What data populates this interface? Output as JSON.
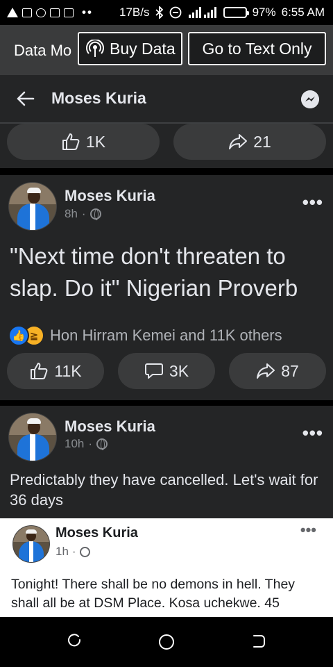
{
  "status_bar": {
    "net_speed": "17B/s",
    "battery": "97%",
    "battery_level": 0.97,
    "time": "6:55 AM"
  },
  "data_banner": {
    "text": "Data Mo",
    "buy_data_label": "Buy Data",
    "go_text_only_label": "Go to Text Only"
  },
  "header": {
    "title": "Moses Kuria"
  },
  "top_actions": {
    "like_count": "1K",
    "share_count": "21"
  },
  "posts": [
    {
      "author": "Moses Kuria",
      "time": "8h",
      "text": "\"Next time don't threaten to slap. Do it\" Nigerian Proverb",
      "reactions_text": "Hon Hirram Kemei and 11K others",
      "like_count": "11K",
      "comment_count": "3K",
      "share_count": "87"
    },
    {
      "author": "Moses Kuria",
      "time": "10h",
      "text": "Predictably they have cancelled.  Let's wait for 36 days",
      "shared_post": {
        "author": "Moses Kuria",
        "time": "1h",
        "text": "Tonight! There shall be no demons in hell. They shall all be at DSM Place. Kosa uchekwe. 45"
      }
    }
  ],
  "colors": {
    "background": "#18191a",
    "card": "#242526",
    "pill": "#3a3b3c",
    "like_blue": "#1877f2",
    "haha_yellow": "#f7b125"
  }
}
